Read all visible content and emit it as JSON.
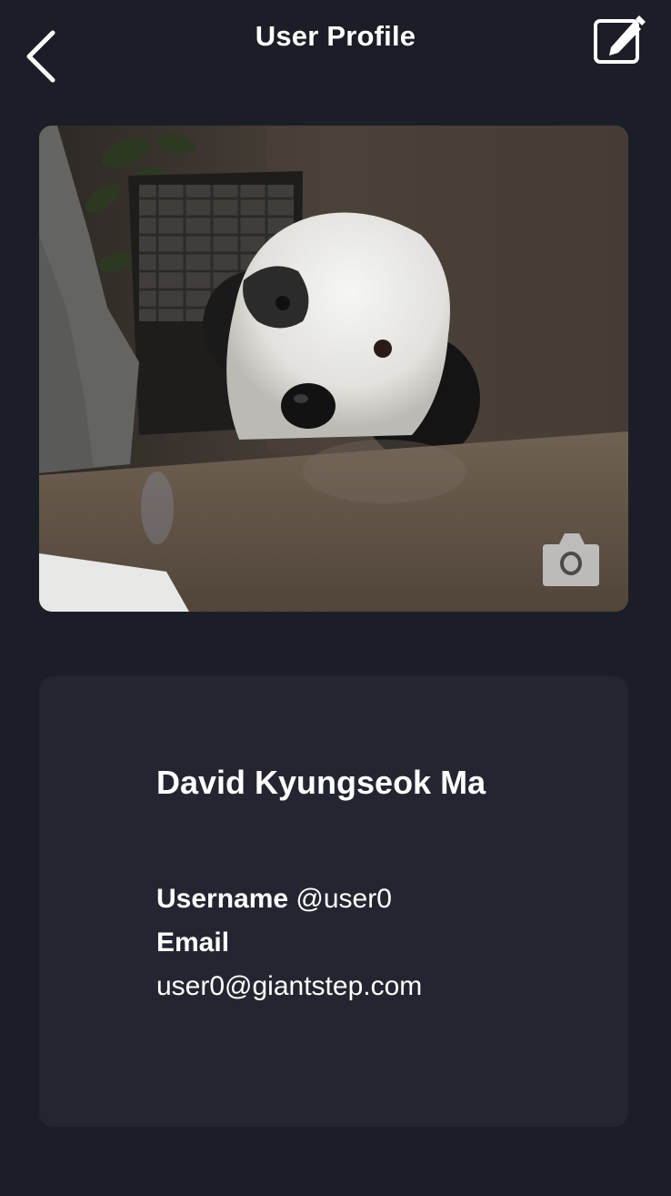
{
  "header": {
    "title": "User Profile",
    "back_icon": "chevron-left-icon",
    "edit_icon": "edit-icon"
  },
  "photo": {
    "subject": "dog",
    "camera_icon": "camera-icon"
  },
  "profile": {
    "full_name": "David Kyungseok Ma",
    "username_label": "Username",
    "username_value": "@user0",
    "email_label": "Email",
    "email_value": "user0@giantstep.com"
  },
  "colors": {
    "background": "#1b1e27",
    "card": "#232631",
    "text": "#ffffff"
  }
}
